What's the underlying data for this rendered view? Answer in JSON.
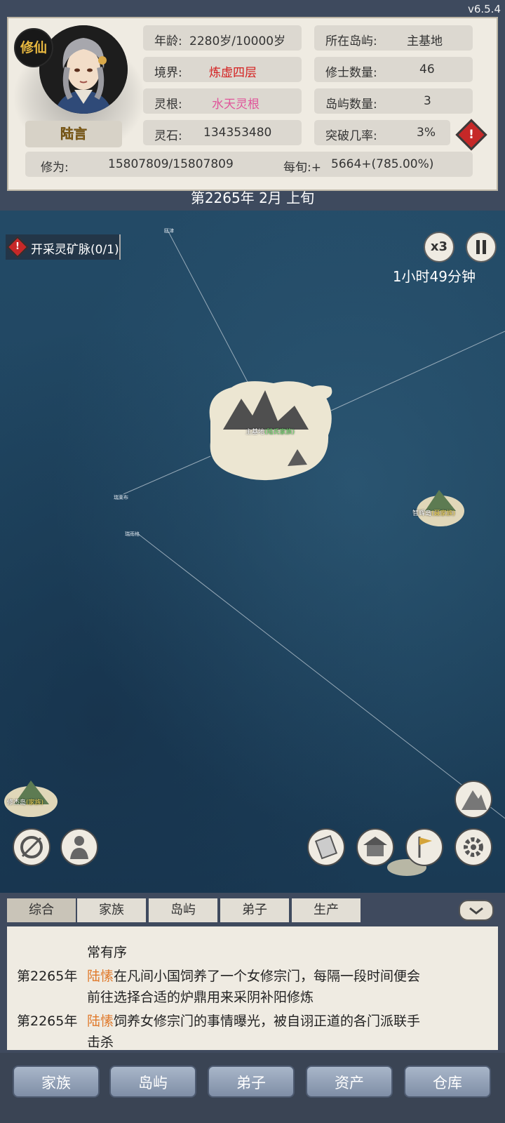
{
  "version": "v6.5.4",
  "header": {
    "badge": "修仙",
    "name": "陆言",
    "stats": {
      "age_label": "年龄:",
      "age_value": "2280岁/10000岁",
      "realm_label": "境界:",
      "realm_value": "炼虚四层",
      "root_label": "灵根:",
      "root_value": "水天灵根",
      "stone_label": "灵石:",
      "stone_value": "134353480",
      "island_label": "所在岛屿:",
      "island_value": "主基地",
      "cultivators_label": "修士数量:",
      "cultivators_value": "46",
      "islands_label": "岛屿数量:",
      "islands_value": "3",
      "breakthrough_label": "突破几率:",
      "breakthrough_value": "3%",
      "xiuwei_label": "修为:",
      "xiuwei_value": "15807809/15807809",
      "per_period_label": "每旬:+",
      "per_period_value": "5664+(785.00%)"
    },
    "date": "第2265年 2月 上旬",
    "colors": {
      "realm": "#d42020",
      "root": "#e0559a",
      "name": "#d4a43a"
    }
  },
  "map": {
    "quest": "开采灵矿脉(0/1)",
    "speed": "x3",
    "pause_icon": "pause-icon",
    "timer": "1小时49分钟",
    "islands": {
      "main": {
        "name": "主基地",
        "tag": "(陆氏家族)"
      },
      "east": {
        "name": "智辉岛",
        "tag": "(聂家族)"
      },
      "southwest": {
        "name": "修杰岛",
        "tag": "(家族)"
      }
    },
    "small_labels": {
      "top": "瓯津",
      "left1": "瑞莱布",
      "left2": "瑞雨格"
    }
  },
  "log": {
    "tabs": [
      "综合",
      "家族",
      "岛屿",
      "弟子",
      "生产"
    ],
    "lines": [
      {
        "year": "",
        "name": "",
        "text": "常有序"
      },
      {
        "year": "第2265年",
        "name": "陆愫",
        "text": "在凡间小国饲养了一个女修宗门，每隔一段时间便会"
      },
      {
        "year": "",
        "name": "",
        "text": "前往选择合适的炉鼎用来采阴补阳修炼"
      },
      {
        "year": "第2265年",
        "name": "陆愫",
        "text": "饲养女修宗门的事情曝光，被自诩正道的各门派联手"
      },
      {
        "year": "",
        "name": "",
        "text": "击杀"
      }
    ]
  },
  "nav": [
    "家族",
    "岛屿",
    "弟子",
    "资产",
    "仓库"
  ]
}
